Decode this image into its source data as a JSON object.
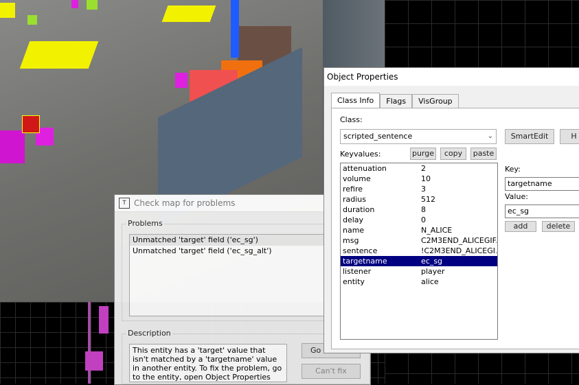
{
  "checkmap": {
    "title": "Check map for problems",
    "problems_label": "Problems",
    "problems": [
      "Unmatched 'target' field ('ec_sg')",
      "Unmatched 'target' field ('ec_sg_alt')"
    ],
    "description_label": "Description",
    "description": "This entity has a 'target' value that isn't matched by a 'targetname' value in another entity. To fix the problem, go to the entity, open Object Properties and select a proper",
    "goto_error": "Go to error",
    "cant_fix": "Can't fix"
  },
  "objprops": {
    "title": "Object Properties",
    "tabs": [
      "Class Info",
      "Flags",
      "VisGroup"
    ],
    "class_label": "Class:",
    "class_value": "scripted_sentence",
    "smartedit": "SmartEdit",
    "help_label": "H",
    "keyvalues_label": "Keyvalues:",
    "purge": "purge",
    "copy": "copy",
    "paste": "paste",
    "keyvalues": [
      {
        "key": "attenuation",
        "value": "2"
      },
      {
        "key": "volume",
        "value": "10"
      },
      {
        "key": "refire",
        "value": "3"
      },
      {
        "key": "radius",
        "value": "512"
      },
      {
        "key": "duration",
        "value": "8"
      },
      {
        "key": "delay",
        "value": "0"
      },
      {
        "key": "name",
        "value": "N_ALICE"
      },
      {
        "key": "msg",
        "value": "C2M3END_ALICEGIF..."
      },
      {
        "key": "sentence",
        "value": "!C2M3END_ALICEGI..."
      },
      {
        "key": "targetname",
        "value": "ec_sg"
      },
      {
        "key": "listener",
        "value": "player"
      },
      {
        "key": "entity",
        "value": "alice"
      }
    ],
    "selected_key": "targetname",
    "key_label": "Key:",
    "key_value": "targetname",
    "value_label": "Value:",
    "value_value": "ec_sg",
    "add": "add",
    "delete": "delete"
  },
  "scene": {
    "accent_magenta": "#e020e0",
    "accent_yellow": "#f2f200",
    "accent_red": "#f05050",
    "accent_orange": "#f07010",
    "selection_blue": "#000080"
  }
}
